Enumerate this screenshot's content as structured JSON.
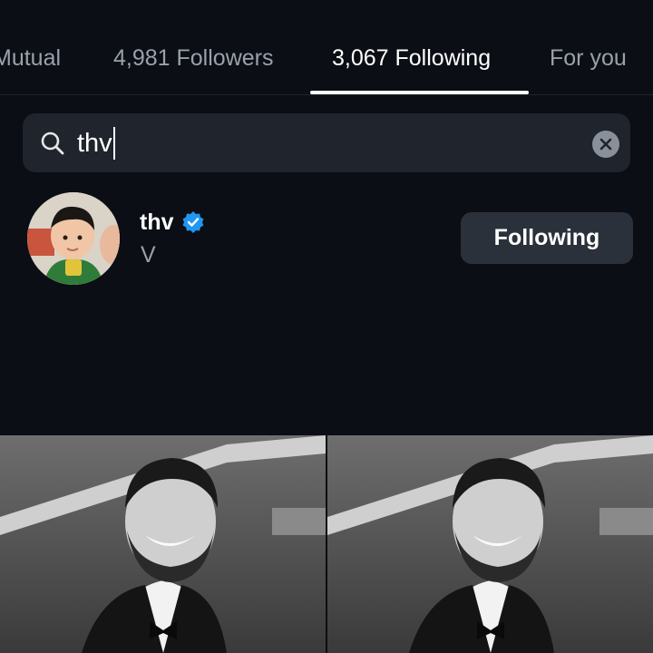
{
  "tabs": [
    {
      "label": "Mutual",
      "active": false
    },
    {
      "label": "4,981 Followers",
      "active": false
    },
    {
      "label": "3,067 Following",
      "active": true
    },
    {
      "label": "For you",
      "active": false
    }
  ],
  "search": {
    "value": "thv",
    "icon": "search-icon",
    "clear_icon": "clear-icon"
  },
  "result": {
    "username": "thv",
    "verified": true,
    "full_name": "V",
    "button_label": "Following"
  },
  "colors": {
    "background": "#0b0e14",
    "search_bg": "#1f242d",
    "button_bg": "#2b313b",
    "verified_blue": "#2196f3",
    "muted_text": "#9aa1ab"
  },
  "grid": {
    "photos": [
      {
        "description_icon": "photo-thumbnail"
      },
      {
        "description_icon": "photo-thumbnail"
      }
    ]
  }
}
